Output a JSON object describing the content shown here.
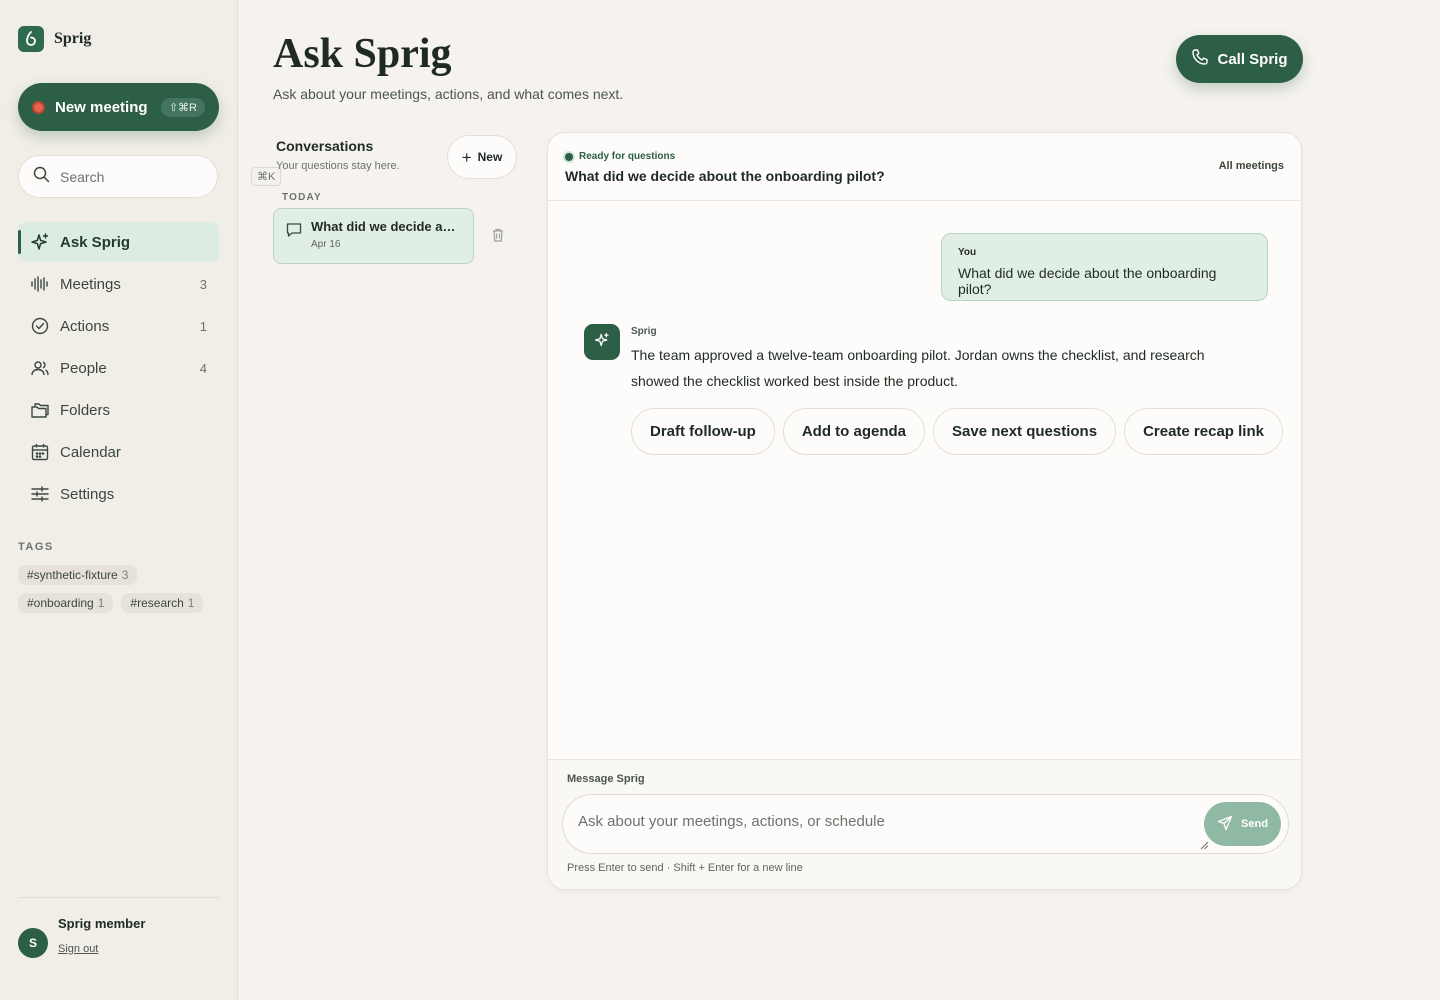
{
  "brand": {
    "name": "Sprig"
  },
  "sidebar": {
    "new_meeting": {
      "label": "New meeting",
      "shortcut": "⇧⌘R"
    },
    "search": {
      "placeholder": "Search",
      "shortcut": "⌘K"
    },
    "items": [
      {
        "label": "Ask Sprig",
        "icon": "sparkle-icon",
        "count": "",
        "active": true
      },
      {
        "label": "Meetings",
        "icon": "waveform-icon",
        "count": "3"
      },
      {
        "label": "Actions",
        "icon": "check-circle-icon",
        "count": "1"
      },
      {
        "label": "People",
        "icon": "people-icon",
        "count": "4"
      },
      {
        "label": "Folders",
        "icon": "folders-icon",
        "count": ""
      },
      {
        "label": "Calendar",
        "icon": "calendar-icon",
        "count": ""
      },
      {
        "label": "Settings",
        "icon": "sliders-icon",
        "count": ""
      }
    ],
    "tags_title": "TAGS",
    "tags": [
      {
        "name": "#synthetic-fixture",
        "count": "3"
      },
      {
        "name": "#onboarding",
        "count": "1"
      },
      {
        "name": "#research",
        "count": "1"
      }
    ],
    "user": {
      "initial": "S",
      "name": "Sprig member",
      "sign_out": "Sign out"
    }
  },
  "header": {
    "title": "Ask Sprig",
    "subtitle": "Ask about your meetings, actions, and what comes next.",
    "call_button": "Call Sprig"
  },
  "conversations": {
    "title": "Conversations",
    "subtitle": "Your questions stay here.",
    "new_button": "New",
    "group_label": "TODAY",
    "items": [
      {
        "title": "What did we decide abo...",
        "date": "Apr 16"
      }
    ]
  },
  "chat": {
    "status": "Ready for questions",
    "title": "What did we decide about the onboarding pilot?",
    "all_meetings": "All meetings",
    "user_message": {
      "who": "You",
      "text": "What did we decide about the onboarding pilot?"
    },
    "assistant_message": {
      "who": "Sprig",
      "text": "The team approved a twelve-team onboarding pilot. Jordan owns the checklist, and research showed the checklist worked best inside the product."
    },
    "actions": [
      "Draft follow-up",
      "Add to agenda",
      "Save next questions",
      "Create recap link"
    ],
    "composer": {
      "label": "Message Sprig",
      "placeholder": "Ask about your meetings, actions, or schedule",
      "value": "",
      "send": "Send",
      "hint": "Press Enter to send · Shift + Enter for a new line"
    }
  },
  "colors": {
    "accent": "#2d5e46",
    "accent_light": "#e1eee5",
    "record": "#e5634d",
    "background": "#f6f3ee"
  }
}
